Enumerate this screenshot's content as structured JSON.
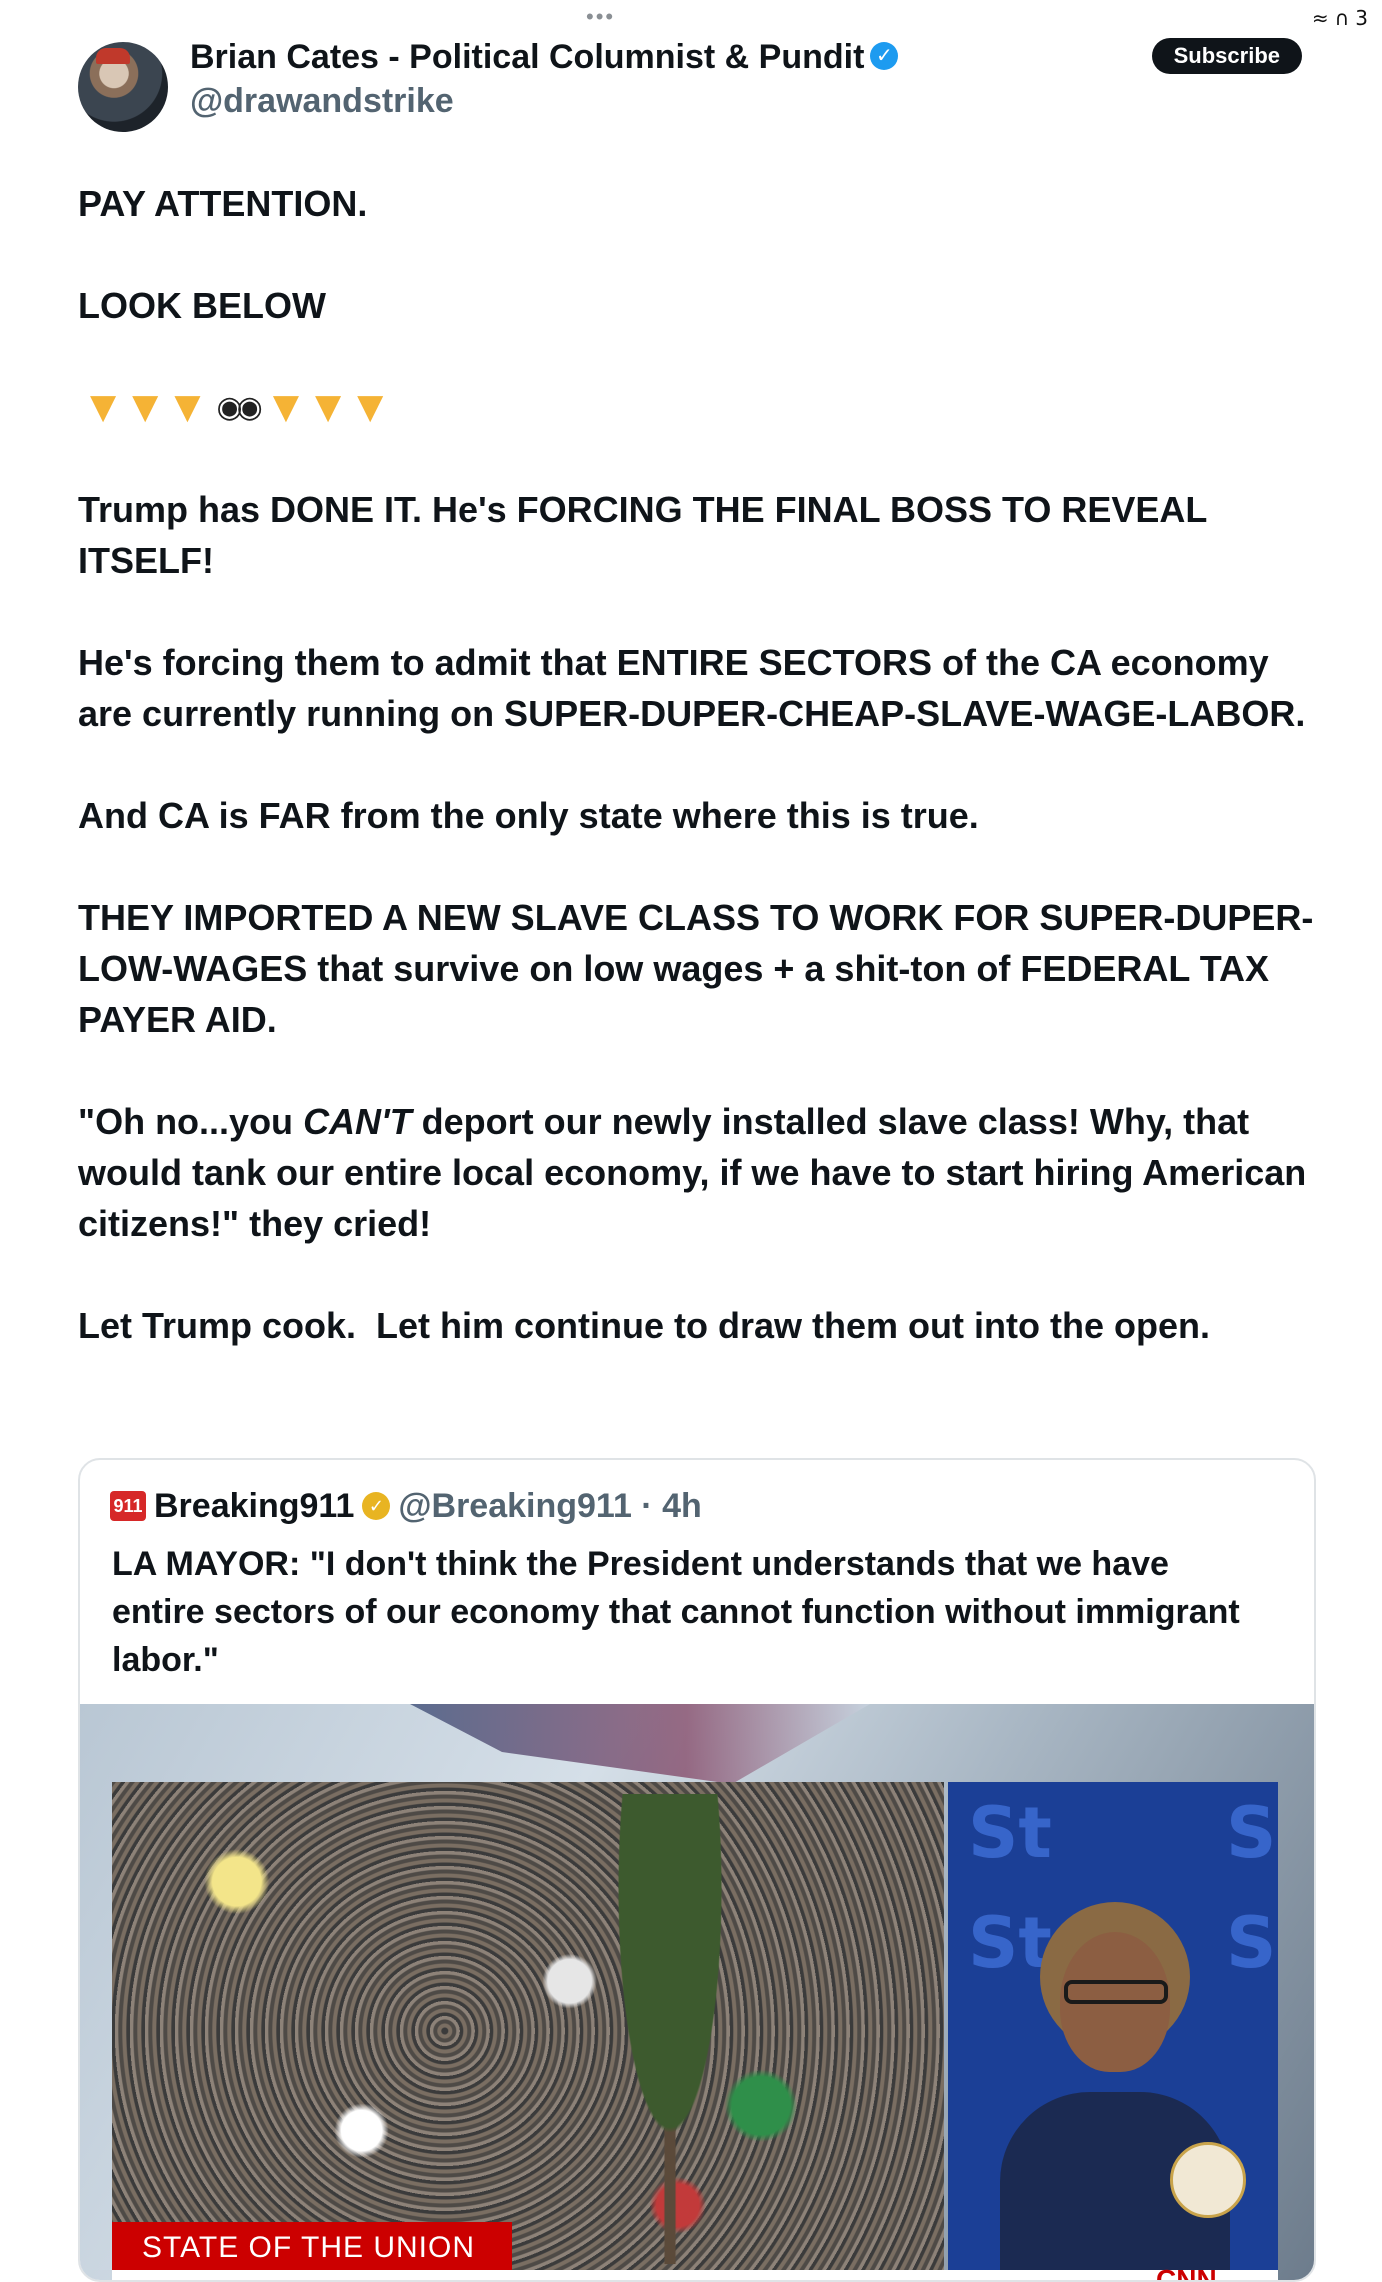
{
  "status_bar": {
    "menu_dots": "•••",
    "wifi_icon": "wifi-icon",
    "headphones_icon": "headphones-icon",
    "count": "3"
  },
  "author": {
    "name": "Brian Cates - Political Columnist & Pundit",
    "handle": "@drawandstrike",
    "verified_icon": "verified-badge-icon",
    "subscribe_label": "Subscribe"
  },
  "post": {
    "line_1": "PAY ATTENTION.",
    "line_2": "LOOK BELOW",
    "emoji_row": [
      "point-down",
      "point-down",
      "point-down",
      "eyes",
      "point-down",
      "point-down",
      "point-down"
    ],
    "para_1": "Trump has DONE IT. He's FORCING THE FINAL BOSS TO REVEAL ITSELF!",
    "para_2": "He's forcing them to admit that ENTIRE SECTORS of the CA economy are currently running on SUPER-DUPER-CHEAP-SLAVE-WAGE-LABOR.",
    "para_3": "And CA is FAR from the only state where this is true.",
    "para_4": "THEY IMPORTED A NEW SLAVE CLASS TO WORK FOR SUPER-DUPER-LOW-WAGES that survive on low wages + a shit-ton of FEDERAL TAX PAYER AID.",
    "para_5_a": "\"Oh no...you ",
    "para_5_em": "CAN'T",
    "para_5_b": " deport our newly installed slave class! Why, that would tank our entire local economy, if we have to start hiring American citizens!\" they cried!",
    "para_6": "Let Trump cook.  Let him continue to draw them out into the open."
  },
  "quote": {
    "logo_text": "911",
    "name": "Breaking911",
    "badge_icon": "gold-verified-badge-icon",
    "handle_time": "@Breaking911 · 4h",
    "text": "LA MAYOR: \"I don't think the President understands that we have entire sectors of our economy that cannot function without immigrant labor.\"",
    "media": {
      "chyron": "STATE OF THE UNION",
      "panel_text_1": "St",
      "panel_text_2": "S",
      "network_logo": "CNN"
    }
  },
  "colors": {
    "text": "#0f1419",
    "secondary": "#536471",
    "verified": "#1d9bf0",
    "chyron_red": "#cc0000"
  }
}
